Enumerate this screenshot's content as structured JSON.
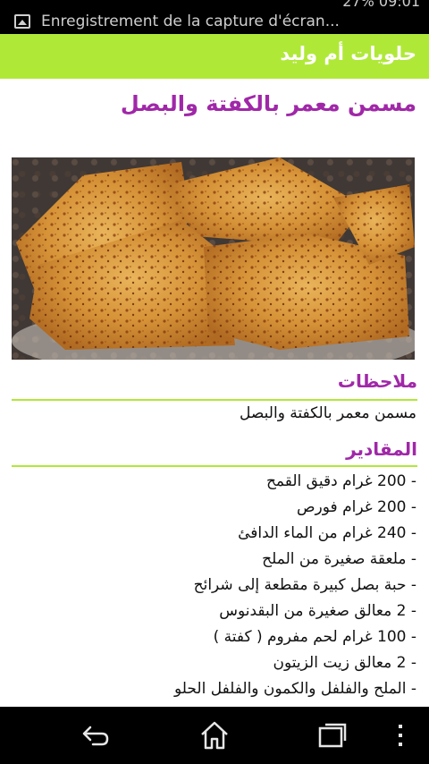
{
  "status_bar": {
    "notification_text": "Enregistrement de la capture d'écran...",
    "right_text": "27% 09:01"
  },
  "app": {
    "title": "حلويات أم وليد"
  },
  "recipe": {
    "title": "مسمن معمر بالكفتة والبصل",
    "image_icon": "photo-of-msemen"
  },
  "notes": {
    "heading": "ملاحظات",
    "text": "مسمن معمر بالكفتة والبصل"
  },
  "ingredients": {
    "heading": "المقادير",
    "items": [
      "- 200 غرام دقيق القمح",
      "- 200 غرام فورص",
      "- 240 غرام من الماء الدافئ",
      "- ملعقة صغيرة من الملح",
      "- حبة بصل كبيرة مقطعة إلى شرائح",
      "- 2 معالق صغيرة من البقدنوس",
      "- 100 غرام لحم مفروم ( كفتة )",
      "- 2 معالق زيت الزيتون",
      "- الملح والفلفل والكمون والفلفل الحلو"
    ]
  },
  "colors": {
    "accent": "#b0e838",
    "heading": "#a028a8"
  },
  "nav": {
    "back_icon": "back-icon",
    "home_icon": "home-icon",
    "recents_icon": "recents-icon",
    "menu_icon": "overflow-menu-icon"
  }
}
